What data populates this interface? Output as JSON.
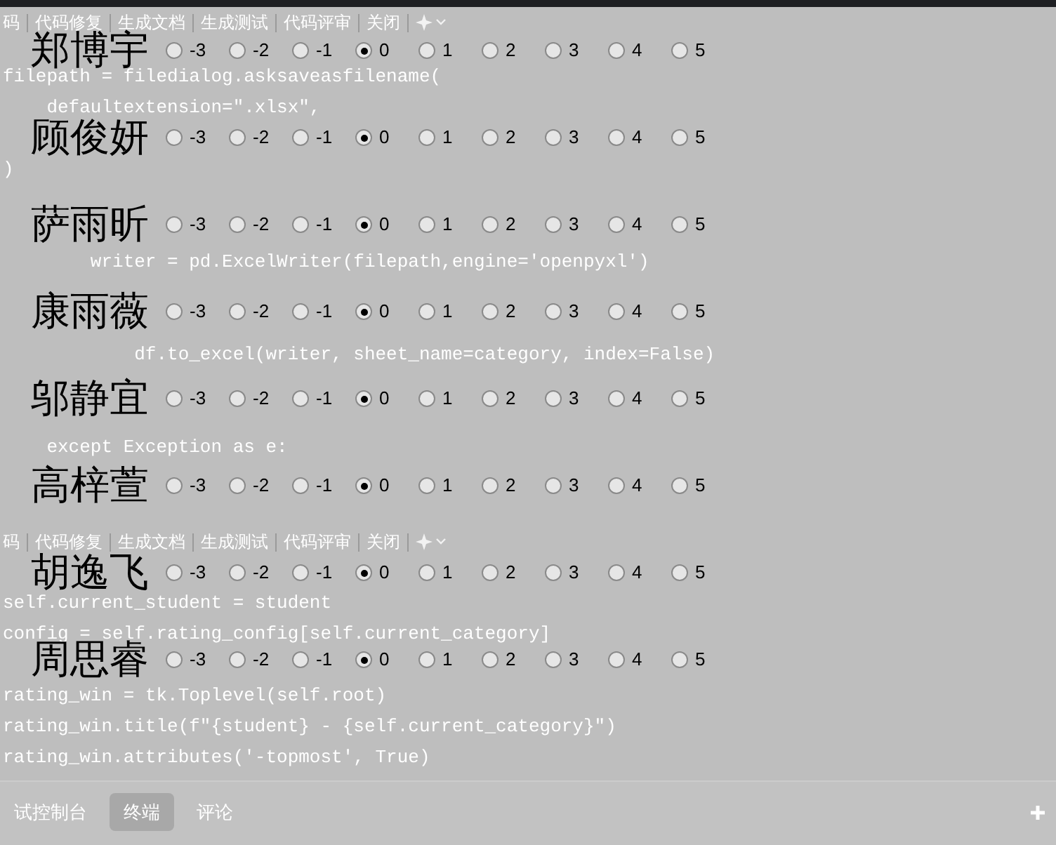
{
  "editor": {
    "toolbar_top": {
      "items": [
        "码",
        "代码修复",
        "生成文档",
        "生成测试",
        "代码评审",
        "关闭"
      ]
    },
    "code_top": [
      {
        "kind": "hidden"
      },
      {
        "kind": "code",
        "text": "filepath = filedialog.asksaveasfilename("
      },
      {
        "kind": "code",
        "text": "    defaultextension=\".xlsx\","
      },
      {
        "kind": "hidden"
      },
      {
        "kind": "code",
        "text": ")"
      },
      {
        "kind": "hidden"
      },
      {
        "kind": "hidden"
      },
      {
        "kind": "code",
        "text": "        writer = pd.ExcelWriter(filepath,engine='openpyxl')"
      },
      {
        "kind": "hidden"
      },
      {
        "kind": "hidden"
      },
      {
        "kind": "code",
        "text": "            df.to_excel(writer, sheet_name=category, index=False)"
      },
      {
        "kind": "hidden"
      },
      {
        "kind": "hidden"
      },
      {
        "kind": "code",
        "text": "    except Exception as e:"
      }
    ],
    "toolbar_bottom": {
      "items": [
        "码",
        "代码修复",
        "生成文档",
        "生成测试",
        "代码评审",
        "关闭"
      ]
    },
    "code_bottom": [
      {
        "kind": "hidden"
      },
      {
        "kind": "code",
        "text": "self.current_student = student"
      },
      {
        "kind": "code",
        "text": "config = self.rating_config[self.current_category]"
      },
      {
        "kind": "hidden"
      },
      {
        "kind": "code",
        "text": "rating_win = tk.Toplevel(self.root)"
      },
      {
        "kind": "code",
        "text": "rating_win.title(f\"{student} - {self.current_category}\")"
      },
      {
        "kind": "code",
        "text": "rating_win.attributes('-topmost', True)"
      }
    ],
    "panel_tabs": [
      {
        "label": "试控制台",
        "selected": false
      },
      {
        "label": "终端",
        "selected": true
      },
      {
        "label": "评论",
        "selected": false
      }
    ]
  },
  "rating_window": {
    "students": [
      {
        "name": "郑博宇",
        "options": [
          {
            "label": "-3",
            "selected": false
          },
          {
            "label": "-2",
            "selected": false
          },
          {
            "label": "-1",
            "selected": false
          },
          {
            "label": "0",
            "selected": true
          },
          {
            "label": "1",
            "selected": false
          },
          {
            "label": "2",
            "selected": false
          },
          {
            "label": "3",
            "selected": false
          },
          {
            "label": "4",
            "selected": false
          },
          {
            "label": "5",
            "selected": false
          }
        ]
      },
      {
        "name": "顾俊妍",
        "options": [
          {
            "label": "-3",
            "selected": false
          },
          {
            "label": "-2",
            "selected": false
          },
          {
            "label": "-1",
            "selected": false
          },
          {
            "label": "0",
            "selected": true
          },
          {
            "label": "1",
            "selected": false
          },
          {
            "label": "2",
            "selected": false
          },
          {
            "label": "3",
            "selected": false
          },
          {
            "label": "4",
            "selected": false
          },
          {
            "label": "5",
            "selected": false
          }
        ]
      },
      {
        "name": "萨雨昕",
        "options": [
          {
            "label": "-3",
            "selected": false
          },
          {
            "label": "-2",
            "selected": false
          },
          {
            "label": "-1",
            "selected": false
          },
          {
            "label": "0",
            "selected": true
          },
          {
            "label": "1",
            "selected": false
          },
          {
            "label": "2",
            "selected": false
          },
          {
            "label": "3",
            "selected": false
          },
          {
            "label": "4",
            "selected": false
          },
          {
            "label": "5",
            "selected": false
          }
        ]
      },
      {
        "name": "康雨薇",
        "options": [
          {
            "label": "-3",
            "selected": false
          },
          {
            "label": "-2",
            "selected": false
          },
          {
            "label": "-1",
            "selected": false
          },
          {
            "label": "0",
            "selected": true
          },
          {
            "label": "1",
            "selected": false
          },
          {
            "label": "2",
            "selected": false
          },
          {
            "label": "3",
            "selected": false
          },
          {
            "label": "4",
            "selected": false
          },
          {
            "label": "5",
            "selected": false
          }
        ]
      },
      {
        "name": "邬静宜",
        "options": [
          {
            "label": "-3",
            "selected": false
          },
          {
            "label": "-2",
            "selected": false
          },
          {
            "label": "-1",
            "selected": false
          },
          {
            "label": "0",
            "selected": true
          },
          {
            "label": "1",
            "selected": false
          },
          {
            "label": "2",
            "selected": false
          },
          {
            "label": "3",
            "selected": false
          },
          {
            "label": "4",
            "selected": false
          },
          {
            "label": "5",
            "selected": false
          }
        ]
      },
      {
        "name": "高梓萱",
        "options": [
          {
            "label": "-3",
            "selected": false
          },
          {
            "label": "-2",
            "selected": false
          },
          {
            "label": "-1",
            "selected": false
          },
          {
            "label": "0",
            "selected": true
          },
          {
            "label": "1",
            "selected": false
          },
          {
            "label": "2",
            "selected": false
          },
          {
            "label": "3",
            "selected": false
          },
          {
            "label": "4",
            "selected": false
          },
          {
            "label": "5",
            "selected": false
          }
        ]
      },
      {
        "name": "胡逸飞",
        "options": [
          {
            "label": "-3",
            "selected": false
          },
          {
            "label": "-2",
            "selected": false
          },
          {
            "label": "-1",
            "selected": false
          },
          {
            "label": "0",
            "selected": true
          },
          {
            "label": "1",
            "selected": false
          },
          {
            "label": "2",
            "selected": false
          },
          {
            "label": "3",
            "selected": false
          },
          {
            "label": "4",
            "selected": false
          },
          {
            "label": "5",
            "selected": false
          }
        ]
      },
      {
        "name": "周思睿",
        "options": [
          {
            "label": "-3",
            "selected": false
          },
          {
            "label": "-2",
            "selected": false
          },
          {
            "label": "-1",
            "selected": false
          },
          {
            "label": "0",
            "selected": true
          },
          {
            "label": "1",
            "selected": false
          },
          {
            "label": "2",
            "selected": false
          },
          {
            "label": "3",
            "selected": false
          },
          {
            "label": "4",
            "selected": false
          },
          {
            "label": "5",
            "selected": false
          }
        ]
      }
    ]
  }
}
